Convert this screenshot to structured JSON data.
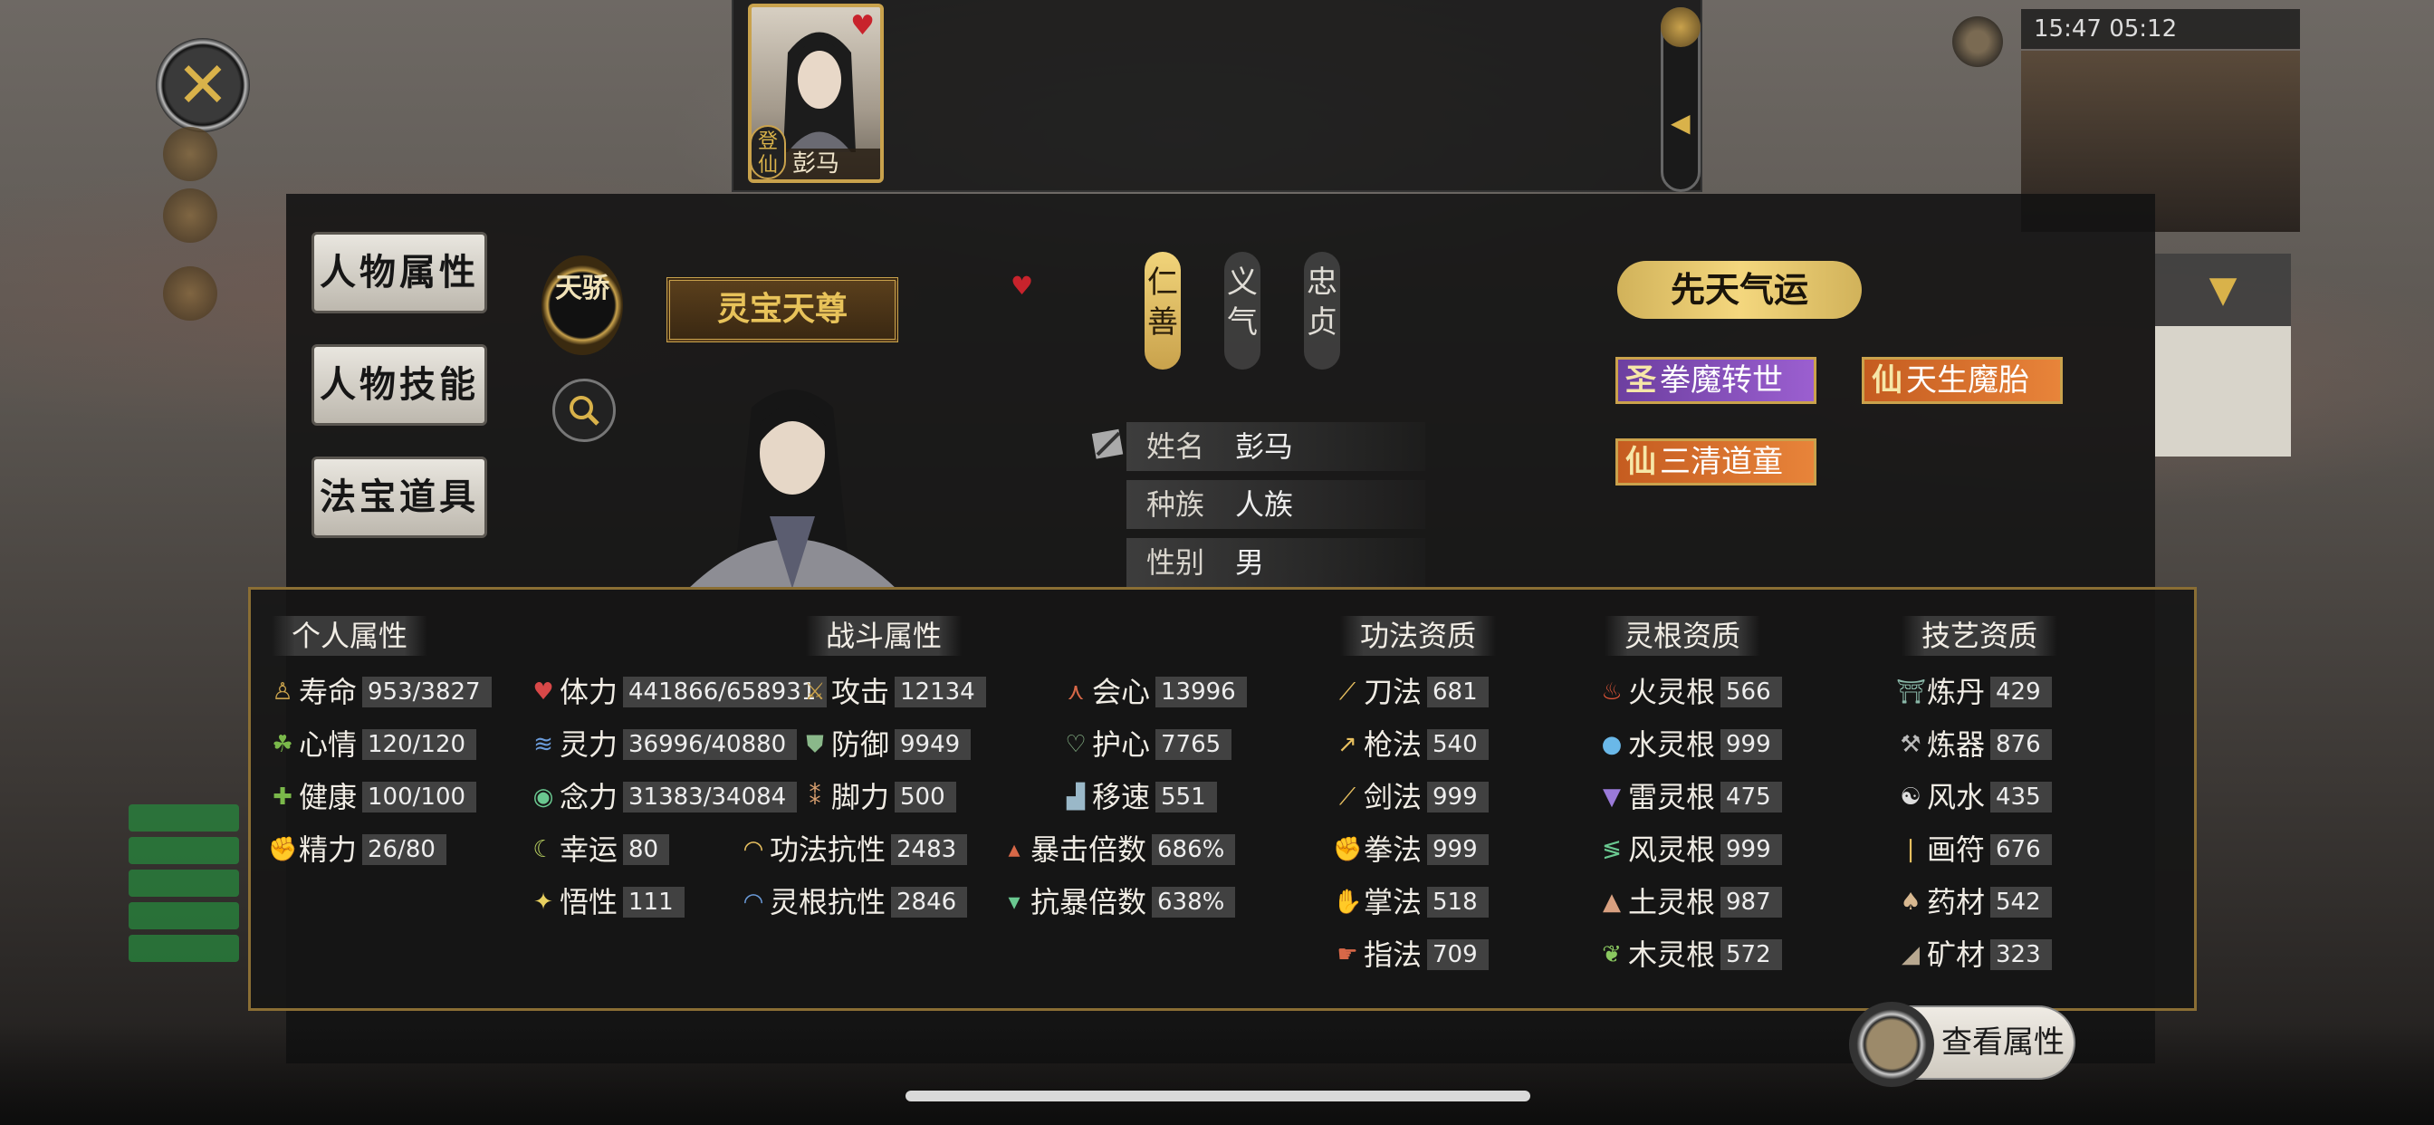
{
  "status_bar": {
    "time": "15:47 05:12"
  },
  "card": {
    "name": "彭马",
    "badge": "登仙"
  },
  "sidebar": {
    "items": [
      {
        "label": "人物属性"
      },
      {
        "label": "人物技能"
      },
      {
        "label": "法宝道具"
      }
    ]
  },
  "profile": {
    "rank_badge": "天骄",
    "title": "灵宝天尊",
    "virtues": [
      {
        "label": "仁善",
        "active": true
      },
      {
        "label": "义气",
        "active": false
      },
      {
        "label": "忠贞",
        "active": false
      }
    ],
    "info": [
      {
        "key": "姓名",
        "value": "彭马"
      },
      {
        "key": "种族",
        "value": "人族"
      },
      {
        "key": "性别",
        "value": "男"
      }
    ]
  },
  "fortune": {
    "header": "先天气运",
    "tags": [
      {
        "glyph": "圣",
        "label": "拳魔转世",
        "color": "purple"
      },
      {
        "glyph": "仙",
        "label": "天生魔胎",
        "color": "orange"
      },
      {
        "glyph": "仙",
        "label": "三清道童",
        "color": "orange"
      }
    ]
  },
  "attributes": {
    "headers": {
      "personal": "个人属性",
      "combat": "战斗属性",
      "technique": "功法资质",
      "spirit_root": "灵根资质",
      "craft": "技艺资质"
    },
    "personal": [
      {
        "icon": "figure-icon",
        "label": "寿命",
        "value": "953/3827"
      },
      {
        "icon": "sprout-icon",
        "label": "心情",
        "value": "120/120"
      },
      {
        "icon": "cross-icon",
        "label": "健康",
        "value": "100/100"
      },
      {
        "icon": "arm-icon",
        "label": "精力",
        "value": "26/80"
      }
    ],
    "combat_col1": [
      {
        "icon": "heart-icon",
        "label": "体力",
        "value": "441866/658931"
      },
      {
        "icon": "wave-icon",
        "label": "灵力",
        "value": "36996/40880"
      },
      {
        "icon": "eye-icon",
        "label": "念力",
        "value": "31383/34084"
      },
      {
        "icon": "moon-icon",
        "label": "幸运",
        "value": "80"
      },
      {
        "icon": "star-icon",
        "label": "悟性",
        "value": "111"
      }
    ],
    "combat_col2": [
      {
        "icon": "swords-icon",
        "label": "攻击",
        "value": "12134"
      },
      {
        "icon": "shield-icon",
        "label": "防御",
        "value": "9949"
      },
      {
        "icon": "footprint-icon",
        "label": "脚力",
        "value": "500"
      },
      {
        "icon": "dome-icon",
        "label": "功法抗性",
        "value": "2483"
      },
      {
        "icon": "dome-outline-icon",
        "label": "灵根抗性",
        "value": "2846"
      }
    ],
    "combat_col3": [
      {
        "icon": "crit-icon",
        "label": "会心",
        "value": "13996"
      },
      {
        "icon": "heart-shield-icon",
        "label": "护心",
        "value": "7765"
      },
      {
        "icon": "boot-icon",
        "label": "移速",
        "value": "551"
      },
      {
        "icon": "triangles-icon",
        "label": "暴击倍数",
        "value": "686%"
      },
      {
        "icon": "down-triangles-icon",
        "label": "抗暴倍数",
        "value": "638%"
      }
    ],
    "technique": [
      {
        "icon": "blade-icon",
        "label": "刀法",
        "value": "681"
      },
      {
        "icon": "spear-icon",
        "label": "枪法",
        "value": "540"
      },
      {
        "icon": "sword-icon",
        "label": "剑法",
        "value": "999"
      },
      {
        "icon": "fist-icon",
        "label": "拳法",
        "value": "999"
      },
      {
        "icon": "palm-icon",
        "label": "掌法",
        "value": "518"
      },
      {
        "icon": "finger-icon",
        "label": "指法",
        "value": "709"
      }
    ],
    "spirit_root": [
      {
        "icon": "fire-icon",
        "label": "火灵根",
        "value": "566"
      },
      {
        "icon": "water-icon",
        "label": "水灵根",
        "value": "999"
      },
      {
        "icon": "thunder-icon",
        "label": "雷灵根",
        "value": "475"
      },
      {
        "icon": "wind-icon",
        "label": "风灵根",
        "value": "999"
      },
      {
        "icon": "earth-icon",
        "label": "土灵根",
        "value": "987"
      },
      {
        "icon": "leaf-icon",
        "label": "木灵根",
        "value": "572"
      }
    ],
    "craft": [
      {
        "icon": "cauldron-icon",
        "label": "炼丹",
        "value": "429"
      },
      {
        "icon": "hammer-icon",
        "label": "炼器",
        "value": "876"
      },
      {
        "icon": "yinyang-icon",
        "label": "风水",
        "value": "435"
      },
      {
        "icon": "scroll-icon",
        "label": "画符",
        "value": "676"
      },
      {
        "icon": "mushroom-icon",
        "label": "药材",
        "value": "542"
      },
      {
        "icon": "ore-icon",
        "label": "矿材",
        "value": "323"
      }
    ]
  },
  "view_button": {
    "label": "查看属性"
  },
  "colors": {
    "gold": "#c9a24c",
    "panel_border": "#8a6e34",
    "purple_tag": "#9b5fd0",
    "orange_tag": "#e8843a"
  }
}
